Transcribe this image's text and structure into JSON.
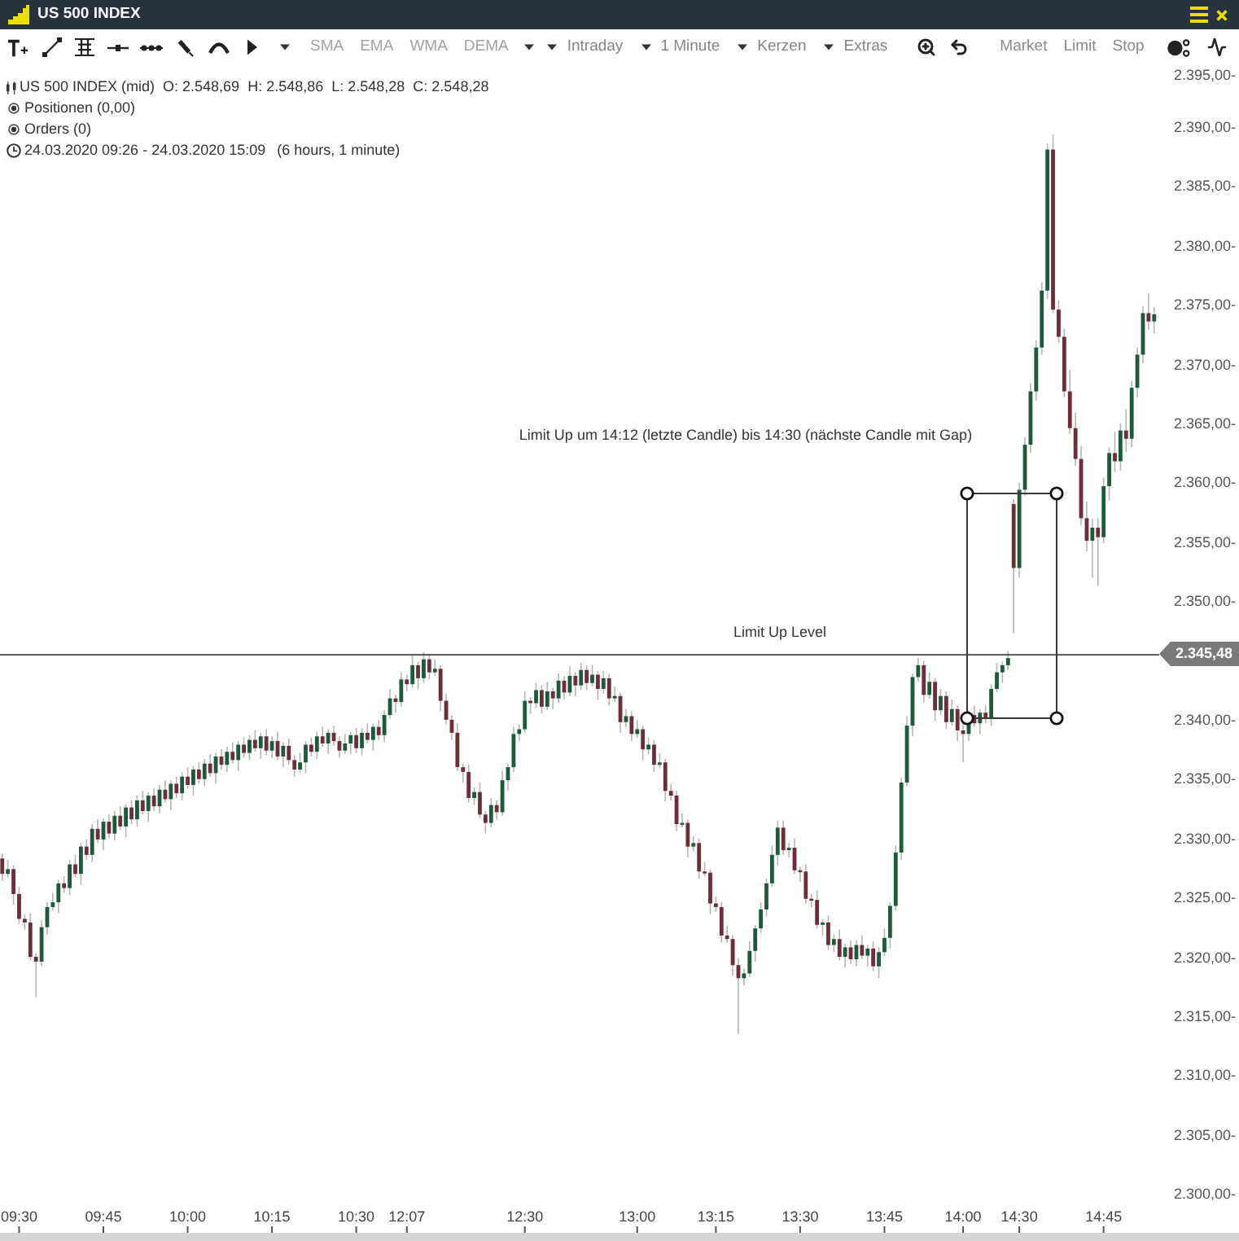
{
  "window": {
    "title": "US 500 INDEX"
  },
  "toolbar": {
    "indicators": [
      "SMA",
      "EMA",
      "WMA",
      "DEMA"
    ],
    "dropdowns": [
      "Intraday",
      "1 Minute",
      "Kerzen",
      "Extras"
    ],
    "order_types": [
      "Market",
      "Limit",
      "Stop"
    ]
  },
  "info": {
    "instrument": [
      "US 500 INDEX (mid)",
      "O: 2.548,69",
      "H: 2.548,86",
      "L: 2.548,28",
      "C: 2.548,28"
    ],
    "positions": "Positionen (0,00)",
    "orders": "Orders (0)",
    "time_range": "24.03.2020 09:26 - 24.03.2020 15:09",
    "duration": "(6 hours, 1 minute)"
  },
  "chart": {
    "chart_data": {
      "type": "candlestick",
      "categories": [
        null,
        null,
        null,
        "09:30",
        null,
        null,
        null,
        null,
        null,
        null,
        null,
        null,
        null,
        null,
        null,
        null,
        null,
        null,
        "09:45",
        null,
        null,
        null,
        null,
        null,
        null,
        null,
        null,
        null,
        null,
        null,
        null,
        null,
        null,
        "10:00",
        null,
        null,
        null,
        null,
        null,
        null,
        null,
        null,
        null,
        null,
        null,
        null,
        null,
        null,
        "10:15",
        null,
        null,
        null,
        null,
        null,
        null,
        null,
        null,
        null,
        null,
        null,
        null,
        null,
        null,
        "10:30",
        null,
        null,
        null,
        null,
        null,
        null,
        null,
        null,
        "12:07",
        null,
        null,
        null,
        null,
        null,
        null,
        null,
        null,
        null,
        null,
        null,
        null,
        null,
        null,
        null,
        null,
        null,
        null,
        null,
        null,
        "12:30",
        null,
        null,
        null,
        null,
        null,
        null,
        null,
        null,
        null,
        null,
        null,
        null,
        null,
        null,
        null,
        null,
        null,
        null,
        null,
        "13:00",
        null,
        null,
        null,
        null,
        null,
        null,
        null,
        null,
        null,
        null,
        null,
        null,
        null,
        "13:15",
        null,
        null,
        null,
        null,
        null,
        null,
        null,
        null,
        null,
        null,
        null,
        null,
        null,
        null,
        "13:30",
        null,
        null,
        null,
        null,
        null,
        null,
        null,
        null,
        null,
        null,
        null,
        null,
        null,
        null,
        "13:45",
        null,
        null,
        null,
        null,
        null,
        null,
        null,
        null,
        null,
        null,
        null,
        null,
        null,
        "14:00",
        null,
        null,
        null,
        null,
        null,
        null,
        null,
        null,
        null,
        "14:30",
        null,
        null,
        null,
        null,
        null,
        null,
        null,
        null,
        null,
        null,
        null,
        null,
        null,
        null,
        "14:45",
        null,
        null,
        null,
        null,
        null,
        null,
        null,
        null,
        null
      ],
      "ohlc": [
        [
          2328.3,
          2328.7,
          2326.4,
          2327.0
        ],
        [
          2327.0,
          2328.2,
          2326.7,
          2327.4
        ],
        [
          2327.4,
          2327.7,
          2324.4,
          2325.3
        ],
        [
          2325.3,
          2325.9,
          2322.8,
          2323.2
        ],
        [
          2323.2,
          2323.6,
          2322.3,
          2322.9
        ],
        [
          2322.9,
          2323.7,
          2319.7,
          2320.0
        ],
        [
          2320.0,
          2320.3,
          2316.6,
          2319.6
        ],
        [
          2319.6,
          2323.1,
          2319.2,
          2322.5
        ],
        [
          2322.5,
          2324.6,
          2321.9,
          2324.2
        ],
        [
          2324.2,
          2325.4,
          2323.9,
          2324.6
        ],
        [
          2324.6,
          2326.5,
          2323.7,
          2326.2
        ],
        [
          2326.2,
          2326.8,
          2325.4,
          2325.8
        ],
        [
          2325.8,
          2328.2,
          2325.2,
          2327.8
        ],
        [
          2327.8,
          2328.6,
          2326.7,
          2327.0
        ],
        [
          2327.0,
          2329.6,
          2326.1,
          2329.3
        ],
        [
          2329.3,
          2329.9,
          2328.2,
          2328.6
        ],
        [
          2328.6,
          2331.2,
          2328.0,
          2330.8
        ],
        [
          2330.8,
          2331.6,
          2329.6,
          2329.9
        ],
        [
          2329.9,
          2331.7,
          2329.0,
          2331.4
        ],
        [
          2331.4,
          2332.0,
          2330.0,
          2330.4
        ],
        [
          2330.4,
          2332.3,
          2329.8,
          2331.9
        ],
        [
          2331.9,
          2332.7,
          2330.7,
          2331.0
        ],
        [
          2331.0,
          2332.9,
          2330.1,
          2332.6
        ],
        [
          2332.6,
          2333.2,
          2331.2,
          2331.6
        ],
        [
          2331.6,
          2333.6,
          2331.0,
          2333.2
        ],
        [
          2333.2,
          2334.0,
          2332.0,
          2332.3
        ],
        [
          2332.3,
          2333.9,
          2331.4,
          2333.6
        ],
        [
          2333.6,
          2334.2,
          2332.3,
          2332.7
        ],
        [
          2332.7,
          2334.5,
          2332.1,
          2334.1
        ],
        [
          2334.1,
          2334.9,
          2333.0,
          2333.3
        ],
        [
          2333.3,
          2334.9,
          2332.4,
          2334.6
        ],
        [
          2334.6,
          2335.2,
          2333.4,
          2333.8
        ],
        [
          2333.8,
          2335.6,
          2333.2,
          2335.2
        ],
        [
          2335.2,
          2336.0,
          2334.2,
          2334.5
        ],
        [
          2334.5,
          2336.1,
          2333.6,
          2335.8
        ],
        [
          2335.8,
          2336.4,
          2334.6,
          2335.0
        ],
        [
          2335.0,
          2336.7,
          2334.4,
          2336.3
        ],
        [
          2336.3,
          2337.1,
          2335.2,
          2335.5
        ],
        [
          2335.5,
          2337.2,
          2334.6,
          2336.9
        ],
        [
          2336.9,
          2337.5,
          2335.8,
          2336.2
        ],
        [
          2336.2,
          2337.7,
          2335.6,
          2337.3
        ],
        [
          2337.3,
          2338.1,
          2336.3,
          2336.6
        ],
        [
          2336.6,
          2338.2,
          2335.7,
          2337.9
        ],
        [
          2337.9,
          2338.5,
          2336.8,
          2337.2
        ],
        [
          2337.2,
          2338.7,
          2336.6,
          2338.3
        ],
        [
          2338.3,
          2339.1,
          2337.3,
          2337.6
        ],
        [
          2337.6,
          2338.9,
          2336.7,
          2338.6
        ],
        [
          2338.6,
          2339.2,
          2337.0,
          2337.4
        ],
        [
          2337.4,
          2338.6,
          2336.8,
          2338.2
        ],
        [
          2338.2,
          2339.0,
          2336.6,
          2336.9
        ],
        [
          2336.9,
          2338.1,
          2336.0,
          2337.8
        ],
        [
          2337.8,
          2338.4,
          2336.2,
          2336.6
        ],
        [
          2336.6,
          2337.0,
          2335.2,
          2335.8
        ],
        [
          2335.8,
          2337.2,
          2335.5,
          2336.4
        ],
        [
          2336.4,
          2338.2,
          2335.5,
          2337.9
        ],
        [
          2337.9,
          2338.5,
          2336.9,
          2337.3
        ],
        [
          2337.3,
          2339.0,
          2336.7,
          2338.6
        ],
        [
          2338.6,
          2339.4,
          2337.7,
          2338.0
        ],
        [
          2338.0,
          2339.2,
          2337.1,
          2338.9
        ],
        [
          2338.9,
          2339.5,
          2337.8,
          2338.2
        ],
        [
          2338.2,
          2338.6,
          2336.8,
          2337.4
        ],
        [
          2337.4,
          2338.8,
          2337.1,
          2338.0
        ],
        [
          2338.0,
          2339.0,
          2337.1,
          2338.7
        ],
        [
          2338.7,
          2339.3,
          2337.2,
          2337.6
        ],
        [
          2337.6,
          2339.3,
          2337.0,
          2338.9
        ],
        [
          2338.9,
          2339.7,
          2338.0,
          2338.3
        ],
        [
          2338.3,
          2339.7,
          2337.4,
          2339.4
        ],
        [
          2339.4,
          2340.0,
          2338.3,
          2338.7
        ],
        [
          2338.7,
          2340.8,
          2338.1,
          2340.4
        ],
        [
          2340.4,
          2342.6,
          2340.1,
          2341.8
        ],
        [
          2341.8,
          2342.1,
          2340.6,
          2341.5
        ],
        [
          2341.5,
          2344.0,
          2341.1,
          2343.4
        ],
        [
          2343.4,
          2343.8,
          2342.4,
          2343.0
        ],
        [
          2343.0,
          2345.4,
          2342.7,
          2344.6
        ],
        [
          2344.6,
          2344.9,
          2342.6,
          2343.5
        ],
        [
          2343.5,
          2345.7,
          2343.1,
          2345.1
        ],
        [
          2345.1,
          2345.5,
          2343.4,
          2344.0
        ],
        [
          2344.0,
          2345.1,
          2343.7,
          2344.3
        ],
        [
          2344.3,
          2344.6,
          2340.7,
          2341.6
        ],
        [
          2341.6,
          2342.2,
          2339.6,
          2340.0
        ],
        [
          2340.0,
          2340.4,
          2338.3,
          2338.9
        ],
        [
          2338.9,
          2339.7,
          2335.7,
          2336.0
        ],
        [
          2336.0,
          2336.3,
          2334.7,
          2335.6
        ],
        [
          2335.6,
          2336.2,
          2333.0,
          2333.4
        ],
        [
          2333.4,
          2334.3,
          2332.8,
          2333.9
        ],
        [
          2333.9,
          2334.7,
          2331.7,
          2332.0
        ],
        [
          2332.0,
          2332.3,
          2330.4,
          2331.3
        ],
        [
          2331.3,
          2333.4,
          2330.9,
          2332.8
        ],
        [
          2332.8,
          2333.2,
          2331.6,
          2332.2
        ],
        [
          2332.2,
          2335.7,
          2331.9,
          2334.9
        ],
        [
          2334.9,
          2336.3,
          2334.0,
          2336.0
        ],
        [
          2336.0,
          2339.4,
          2335.6,
          2338.8
        ],
        [
          2338.8,
          2339.6,
          2338.2,
          2339.2
        ],
        [
          2339.2,
          2342.4,
          2338.9,
          2341.6
        ],
        [
          2341.6,
          2341.9,
          2340.5,
          2341.4
        ],
        [
          2341.4,
          2343.1,
          2341.0,
          2342.5
        ],
        [
          2342.5,
          2342.9,
          2340.5,
          2341.1
        ],
        [
          2341.1,
          2343.2,
          2340.8,
          2342.4
        ],
        [
          2342.4,
          2342.7,
          2340.9,
          2341.8
        ],
        [
          2341.8,
          2343.9,
          2341.4,
          2343.3
        ],
        [
          2343.3,
          2343.7,
          2341.7,
          2342.3
        ],
        [
          2342.3,
          2344.5,
          2342.0,
          2343.7
        ],
        [
          2343.7,
          2344.0,
          2342.0,
          2342.9
        ],
        [
          2342.9,
          2344.8,
          2342.5,
          2344.2
        ],
        [
          2344.2,
          2344.6,
          2342.5,
          2343.1
        ],
        [
          2343.1,
          2344.6,
          2342.8,
          2343.8
        ],
        [
          2343.8,
          2344.1,
          2341.7,
          2342.6
        ],
        [
          2342.6,
          2344.1,
          2342.2,
          2343.5
        ],
        [
          2343.5,
          2343.9,
          2341.2,
          2341.8
        ],
        [
          2341.8,
          2342.8,
          2341.5,
          2342.0
        ],
        [
          2342.0,
          2342.3,
          2338.9,
          2339.8
        ],
        [
          2339.8,
          2340.9,
          2339.4,
          2340.3
        ],
        [
          2340.3,
          2340.7,
          2338.2,
          2338.8
        ],
        [
          2338.8,
          2340.0,
          2338.5,
          2339.2
        ],
        [
          2339.2,
          2339.5,
          2336.6,
          2337.5
        ],
        [
          2337.5,
          2338.5,
          2337.1,
          2337.9
        ],
        [
          2337.9,
          2338.3,
          2335.6,
          2336.2
        ],
        [
          2336.2,
          2337.2,
          2335.9,
          2336.4
        ],
        [
          2336.4,
          2336.7,
          2333.1,
          2334.0
        ],
        [
          2334.0,
          2334.6,
          2333.2,
          2333.6
        ],
        [
          2333.6,
          2334.0,
          2330.6,
          2331.2
        ],
        [
          2331.2,
          2332.1,
          2330.9,
          2331.3
        ],
        [
          2331.3,
          2331.6,
          2328.4,
          2329.3
        ],
        [
          2329.3,
          2330.2,
          2328.9,
          2329.6
        ],
        [
          2329.6,
          2330.0,
          2326.6,
          2327.2
        ],
        [
          2327.2,
          2328.0,
          2326.8,
          2327.1
        ],
        [
          2327.1,
          2327.4,
          2323.6,
          2324.5
        ],
        [
          2324.5,
          2325.1,
          2323.8,
          2324.2
        ],
        [
          2324.2,
          2324.6,
          2321.2,
          2321.8
        ],
        [
          2321.8,
          2322.6,
          2321.2,
          2321.5
        ],
        [
          2321.5,
          2321.8,
          2318.4,
          2319.3
        ],
        [
          2319.3,
          2319.9,
          2313.5,
          2318.2
        ],
        [
          2318.2,
          2319.0,
          2317.6,
          2318.6
        ],
        [
          2318.6,
          2321.3,
          2318.3,
          2320.5
        ],
        [
          2320.5,
          2322.7,
          2319.6,
          2322.4
        ],
        [
          2322.4,
          2324.6,
          2322.0,
          2324.0
        ],
        [
          2324.0,
          2326.6,
          2323.4,
          2326.2
        ],
        [
          2326.2,
          2329.4,
          2325.9,
          2328.6
        ],
        [
          2328.6,
          2331.5,
          2327.7,
          2330.9
        ],
        [
          2330.9,
          2331.5,
          2328.6,
          2329.0
        ],
        [
          2329.0,
          2329.6,
          2328.4,
          2329.2
        ],
        [
          2329.2,
          2330.0,
          2327.0,
          2327.3
        ],
        [
          2327.3,
          2327.6,
          2326.3,
          2327.2
        ],
        [
          2327.2,
          2327.8,
          2324.5,
          2324.9
        ],
        [
          2324.9,
          2325.3,
          2324.2,
          2324.8
        ],
        [
          2324.8,
          2325.6,
          2322.4,
          2322.7
        ],
        [
          2322.7,
          2323.2,
          2321.8,
          2322.9
        ],
        [
          2322.9,
          2323.5,
          2320.6,
          2321.0
        ],
        [
          2321.0,
          2321.9,
          2320.4,
          2321.5
        ],
        [
          2321.5,
          2322.3,
          2319.7,
          2320.0
        ],
        [
          2320.0,
          2321.1,
          2319.1,
          2320.8
        ],
        [
          2320.8,
          2321.4,
          2319.4,
          2319.8
        ],
        [
          2319.8,
          2321.4,
          2319.2,
          2321.0
        ],
        [
          2321.0,
          2321.8,
          2319.8,
          2320.1
        ],
        [
          2320.1,
          2321.0,
          2319.2,
          2320.7
        ],
        [
          2320.7,
          2321.3,
          2318.8,
          2319.2
        ],
        [
          2319.2,
          2320.8,
          2318.2,
          2320.4
        ],
        [
          2320.4,
          2322.4,
          2320.1,
          2321.6
        ],
        [
          2321.6,
          2324.6,
          2320.7,
          2324.3
        ],
        [
          2324.3,
          2329.4,
          2323.9,
          2328.8
        ],
        [
          2328.8,
          2335.1,
          2328.2,
          2334.7
        ],
        [
          2334.7,
          2340.3,
          2334.4,
          2339.5
        ],
        [
          2339.5,
          2343.9,
          2338.6,
          2343.6
        ],
        [
          2343.6,
          2345.2,
          2343.2,
          2344.6
        ],
        [
          2344.6,
          2345.0,
          2341.5,
          2342.1
        ],
        [
          2342.1,
          2344.0,
          2341.8,
          2343.2
        ],
        [
          2343.2,
          2343.5,
          2339.9,
          2340.8
        ],
        [
          2340.8,
          2342.6,
          2340.4,
          2342.0
        ],
        [
          2342.0,
          2342.4,
          2339.2,
          2339.8
        ],
        [
          2339.8,
          2341.7,
          2339.5,
          2340.9
        ],
        [
          2340.9,
          2341.2,
          2338.2,
          2339.1
        ],
        [
          2339.1,
          2339.7,
          2336.4,
          2338.8
        ],
        [
          2338.8,
          2340.8,
          2338.2,
          2340.4
        ],
        [
          2340.4,
          2341.2,
          2339.4,
          2339.7
        ],
        [
          2339.7,
          2340.9,
          2338.8,
          2340.6
        ],
        [
          2340.6,
          2341.2,
          2339.7,
          2340.1
        ],
        [
          2340.1,
          2343.0,
          2339.5,
          2342.6
        ],
        [
          2342.6,
          2344.8,
          2342.3,
          2344.0
        ],
        [
          2344.0,
          2344.9,
          2343.1,
          2344.6
        ],
        [
          2344.6,
          2345.8,
          2344.2,
          2345.2
        ],
        [
          2358.2,
          2358.6,
          2347.3,
          2352.8
        ],
        [
          2352.8,
          2360.0,
          2352.0,
          2359.4
        ],
        [
          2359.4,
          2363.8,
          2358.9,
          2363.2
        ],
        [
          2363.2,
          2368.4,
          2362.5,
          2367.7
        ],
        [
          2367.7,
          2372.0,
          2366.9,
          2371.4
        ],
        [
          2371.4,
          2376.9,
          2370.8,
          2376.2
        ],
        [
          2376.2,
          2388.6,
          2375.5,
          2388.1
        ],
        [
          2388.1,
          2389.4,
          2374.3,
          2374.6
        ],
        [
          2374.6,
          2375.4,
          2371.8,
          2372.3
        ],
        [
          2372.3,
          2373.0,
          2367.2,
          2367.7
        ],
        [
          2367.7,
          2369.5,
          2364.1,
          2364.6
        ],
        [
          2364.6,
          2365.9,
          2361.4,
          2362.0
        ],
        [
          2362.0,
          2363.1,
          2356.4,
          2357.0
        ],
        [
          2357.0,
          2358.4,
          2354.2,
          2355.1
        ],
        [
          2355.1,
          2356.9,
          2352.0,
          2356.2
        ],
        [
          2356.2,
          2357.0,
          2351.3,
          2355.4
        ],
        [
          2355.4,
          2360.4,
          2354.9,
          2359.7
        ],
        [
          2359.7,
          2363.0,
          2358.5,
          2362.5
        ],
        [
          2362.5,
          2364.3,
          2360.9,
          2361.8
        ],
        [
          2361.8,
          2365.0,
          2361.0,
          2364.4
        ],
        [
          2364.4,
          2366.2,
          2362.6,
          2363.7
        ],
        [
          2363.7,
          2368.6,
          2363.0,
          2368.0
        ],
        [
          2368.0,
          2371.4,
          2367.2,
          2370.8
        ],
        [
          2370.8,
          2374.9,
          2370.1,
          2374.3
        ],
        [
          2374.3,
          2376.0,
          2372.9,
          2373.6
        ],
        [
          2373.6,
          2374.8,
          2372.6,
          2374.2
        ]
      ],
      "ylim": [
        2300,
        2395
      ],
      "yticks": [
        {
          "value": 2395,
          "label": "2.395,00-"
        },
        {
          "value": 2390,
          "label": "2.390,00-"
        },
        {
          "value": 2385,
          "label": "2.385,00-"
        },
        {
          "value": 2380,
          "label": "2.380,00-"
        },
        {
          "value": 2375,
          "label": "2.375,00-"
        },
        {
          "value": 2370,
          "label": "2.370,00-"
        },
        {
          "value": 2365,
          "label": "2.365,00-"
        },
        {
          "value": 2360,
          "label": "2.360,00-"
        },
        {
          "value": 2355,
          "label": "2.355,00-"
        },
        {
          "value": 2350,
          "label": "2.350,00-"
        },
        {
          "value": 2340,
          "label": "2.340,00-"
        },
        {
          "value": 2335,
          "label": "2.335,00-"
        },
        {
          "value": 2330,
          "label": "2.330,00-"
        },
        {
          "value": 2325,
          "label": "2.325,00-"
        },
        {
          "value": 2320,
          "label": "2.320,00-"
        },
        {
          "value": 2315,
          "label": "2.315,00-"
        },
        {
          "value": 2310,
          "label": "2.310,00-"
        },
        {
          "value": 2305,
          "label": "2.305,00-"
        },
        {
          "value": 2300,
          "label": "2.300,00-"
        }
      ],
      "ref_lines": [
        {
          "axis": "y",
          "value": 2345.48,
          "label": "2.345,48"
        }
      ],
      "annotations": [
        "Limit Up um 14:12 (letzte Candle) bis 14:30 (nächste Candle mit Gap)",
        "Limit Up Level"
      ]
    }
  }
}
